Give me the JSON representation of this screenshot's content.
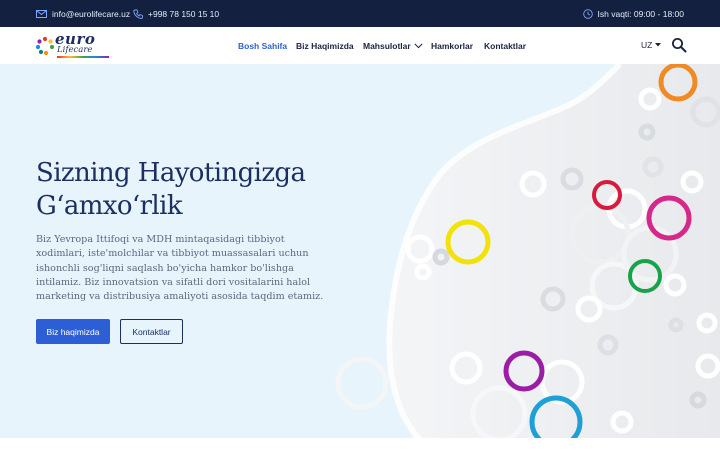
{
  "topbar": {
    "email": "info@eurolifecare.uz",
    "phone": "+998 78 150 15 10",
    "hours": "Ish vaqti: 09:00 - 18:00",
    "icons": [
      "mail-icon",
      "phone-icon",
      "clock-icon"
    ]
  },
  "logo": {
    "line1": "euro",
    "line2": "Lifecare"
  },
  "nav": {
    "items": [
      {
        "label": "Bosh Sahifa",
        "active": true
      },
      {
        "label": "Biz Haqimizda"
      },
      {
        "label": "Mahsulotlar"
      },
      {
        "label": "Hamkorlar"
      },
      {
        "label": "Kontaktlar"
      }
    ],
    "language": "UZ"
  },
  "hero": {
    "title_line1": "Sizning Hayotingizga",
    "title_line2": "G‘amxo‘rlik",
    "text": "Biz Yevropa Ittifoqi va MDH mintaqasidagi tibbiyot xodimlari, iste'molchilar va tibbiyot muassasalari uchun ishonchli sog'liqni saqlash bo'yicha hamkor bo'lishga intilamiz. Biz innovatsion va sifatli dori vositalarini halol marketing va distribusiya amaliyoti asosida taqdim etamiz.",
    "primary_button": "Biz haqimizda",
    "secondary_button": "Kontaktlar"
  },
  "colors": {
    "topbar_bg": "#13203f",
    "accent": "#2c5fd6",
    "title": "#1b2f63",
    "hero_bg": "#e8f4fb"
  }
}
